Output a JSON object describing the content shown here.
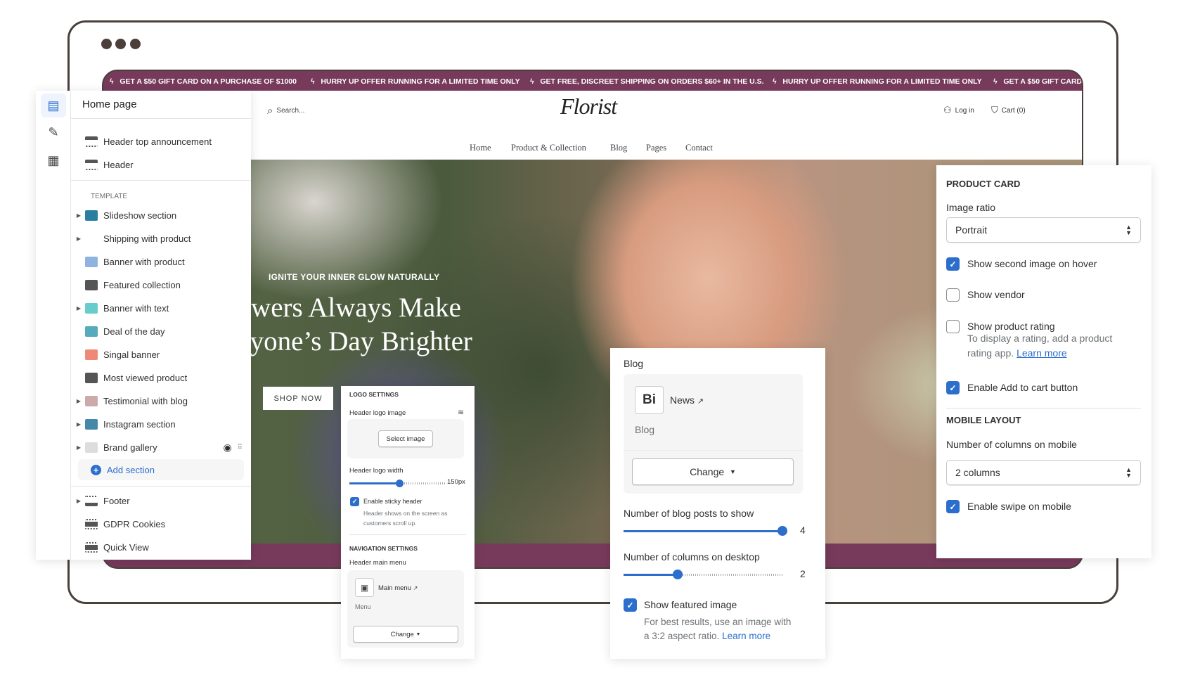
{
  "browser": {
    "window_dots": 3
  },
  "store": {
    "announcements": [
      "GET A $50 GIFT CARD ON A PURCHASE OF $1000",
      "HURRY UP OFFER RUNNING FOR A LIMITED TIME ONLY",
      "GET FREE, DISCREET SHIPPING ON ORDERS $60+ IN THE U.S.",
      "HURRY UP OFFER RUNNING FOR A LIMITED TIME ONLY",
      "GET A $50 GIFT CARD"
    ],
    "search_placeholder": "Search...",
    "logo": "Florist",
    "login": "Log in",
    "cart": "Cart (0)",
    "nav": [
      "Home",
      "Product & Collection",
      "Blog",
      "Pages",
      "Contact"
    ],
    "hero": {
      "subtitle": "IGNITE YOUR INNER GLOW NATURALLY",
      "title_line1": "Flowers Always Make",
      "title_line2": "Everyone’s Day Brighter",
      "cta": "SHOP NOW"
    },
    "brand_color": "#773a5b"
  },
  "sidebar": {
    "title": "Home page",
    "header_items": [
      "Header top announcement",
      "Header"
    ],
    "template_label": "TEMPLATE",
    "template_items": [
      {
        "label": "Slideshow section",
        "expandable": true
      },
      {
        "label": "Shipping with product",
        "expandable": true
      },
      {
        "label": "Banner with product",
        "expandable": false
      },
      {
        "label": "Featured collection",
        "expandable": false
      },
      {
        "label": "Banner with text",
        "expandable": true
      },
      {
        "label": "Deal of the day",
        "expandable": false
      },
      {
        "label": "Singal banner",
        "expandable": false
      },
      {
        "label": "Most viewed product",
        "expandable": false
      },
      {
        "label": "Testimonial with blog",
        "expandable": true
      },
      {
        "label": "Instagram section",
        "expandable": true
      },
      {
        "label": "Brand gallery",
        "expandable": true
      }
    ],
    "add_section": "Add section",
    "footer_items": [
      {
        "label": "Footer",
        "expandable": true
      },
      {
        "label": "GDPR Cookies",
        "expandable": false
      },
      {
        "label": "Quick View",
        "expandable": false
      }
    ],
    "accent": "#2c6ecb"
  },
  "logo_settings": {
    "heading": "LOGO SETTINGS",
    "logo_image_label": "Header logo image",
    "select_image": "Select image",
    "logo_width_label": "Header logo width",
    "logo_width_value": "150px",
    "logo_width_fill_percent": 52,
    "sticky_label": "Enable sticky header",
    "sticky_checked": true,
    "sticky_desc": "Header shows on the screen as customers scroll up.",
    "nav_heading": "NAVIGATION SETTINGS",
    "menu_label": "Header main menu",
    "menu_name": "Main menu",
    "menu_type": "Menu",
    "change": "Change"
  },
  "blog_settings": {
    "label": "Blog",
    "blog_name": "News",
    "blog_type": "Blog",
    "change": "Change",
    "posts_label": "Number of blog posts to show",
    "posts_value": "4",
    "posts_fill_percent": 100,
    "columns_label": "Number of columns on desktop",
    "columns_value": "2",
    "columns_fill_percent": 34,
    "featured_label": "Show featured image",
    "featured_checked": true,
    "featured_desc": "For best results, use an image with a 3:2 aspect ratio.",
    "learn_more": "Learn more"
  },
  "product_card": {
    "heading": "PRODUCT CARD",
    "ratio_label": "Image ratio",
    "ratio_value": "Portrait",
    "options": [
      {
        "label": "Show second image on hover",
        "checked": true
      },
      {
        "label": "Show vendor",
        "checked": false
      },
      {
        "label": "Show product rating",
        "checked": false
      },
      {
        "label": "Enable Add to cart button",
        "checked": true
      }
    ],
    "rating_desc": "To display a rating, add a product rating app.",
    "learn_more": "Learn more",
    "mobile_heading": "MOBILE LAYOUT",
    "mobile_cols_label": "Number of columns on mobile",
    "mobile_cols_value": "2 columns",
    "swipe_label": "Enable swipe on mobile",
    "swipe_checked": true
  }
}
